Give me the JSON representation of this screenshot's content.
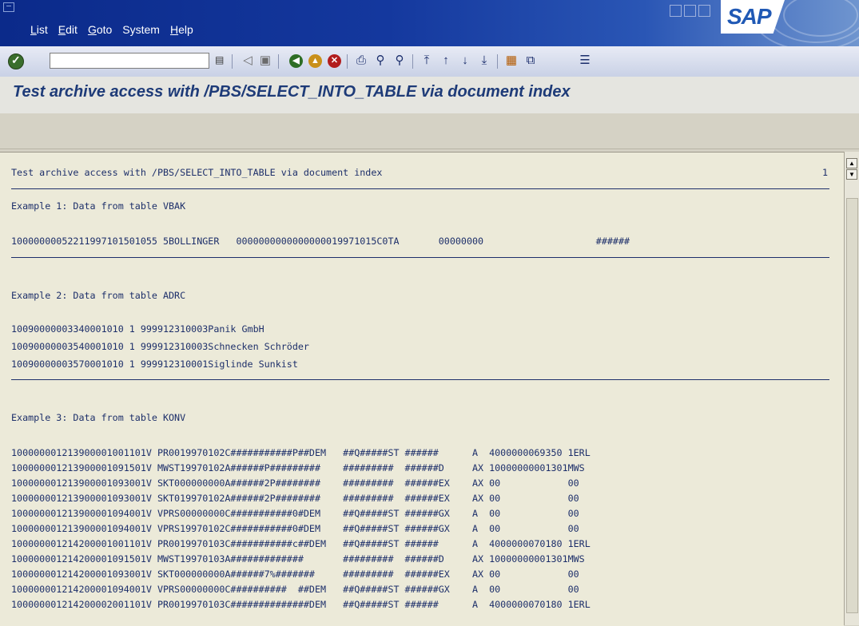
{
  "window": {
    "brand": "SAP"
  },
  "menu": {
    "items": [
      {
        "accel": "L",
        "rest": "ist"
      },
      {
        "accel": "E",
        "rest": "dit"
      },
      {
        "accel": "G",
        "rest": "oto"
      },
      {
        "accel": "",
        "rest": "System"
      },
      {
        "accel": "H",
        "rest": "elp"
      }
    ]
  },
  "toolbar": {
    "command_value": "",
    "icons": [
      "enter-icon",
      "command-history-icon",
      "back-arrow-icon",
      "save-icon",
      "back-icon",
      "exit-icon",
      "cancel-icon",
      "print-icon",
      "find-icon",
      "find-next-icon",
      "first-page-icon",
      "previous-page-icon",
      "next-page-icon",
      "last-page-icon",
      "create-session-icon",
      "shortcut-icon",
      "layout-menu-icon"
    ]
  },
  "title": "Test archive access with /PBS/SELECT_INTO_TABLE via document index",
  "list": {
    "header": "Test archive access with /PBS/SELECT_INTO_TABLE via document index",
    "page": "1",
    "example1": {
      "heading": "Example 1: Data from table VBAK",
      "rows": [
        "10000000052211997101501055 5BOLLINGER   0000000000000000019971015C0TA       00000000                    ######"
      ]
    },
    "example2": {
      "heading": "Example 2: Data from table ADRC",
      "rows": [
        "10090000003340001010 1 999912310003Panik GmbH",
        "10090000003540001010 1 999912310003Schnecken Schröder",
        "10090000003570001010 1 999912310001Siglinde Sunkist"
      ]
    },
    "example3": {
      "heading": "Example 3: Data from table KONV",
      "rows": [
        "100000001213900001001101V PR0019970102C###########P##DEM   ##Q#####ST ######      A  4000000069350 1ERL",
        "100000001213900001091501V MWST19970102A######P#########    #########  ######D     AX 10000000001301MWS",
        "100000001213900001093001V SKT000000000A######2P########    #########  ######EX    AX 00            00",
        "100000001213900001093001V SKT019970102A######2P########    #########  ######EX    AX 00            00",
        "100000001213900001094001V VPRS00000000C###########0#DEM    ##Q#####ST ######GX    A  00            00",
        "100000001213900001094001V VPRS19970102C###########0#DEM    ##Q#####ST ######GX    A  00            00",
        "100000001214200001001101V PR0019970103C###########c##DEM   ##Q#####ST ######      A  4000000070180 1ERL",
        "100000001214200001091501V MWST19970103A#############       #########  ######D     AX 10000000001301MWS",
        "100000001214200001093001V SKT000000000A######7%#######     #########  ######EX    AX 00            00",
        "100000001214200001094001V VPRS00000000C##########  ##DEM   ##Q#####ST ######GX    A  00            00",
        "100000001214200002001101V PR0019970103C##############DEM   ##Q#####ST ######      A  4000000070180 1ERL"
      ]
    }
  }
}
